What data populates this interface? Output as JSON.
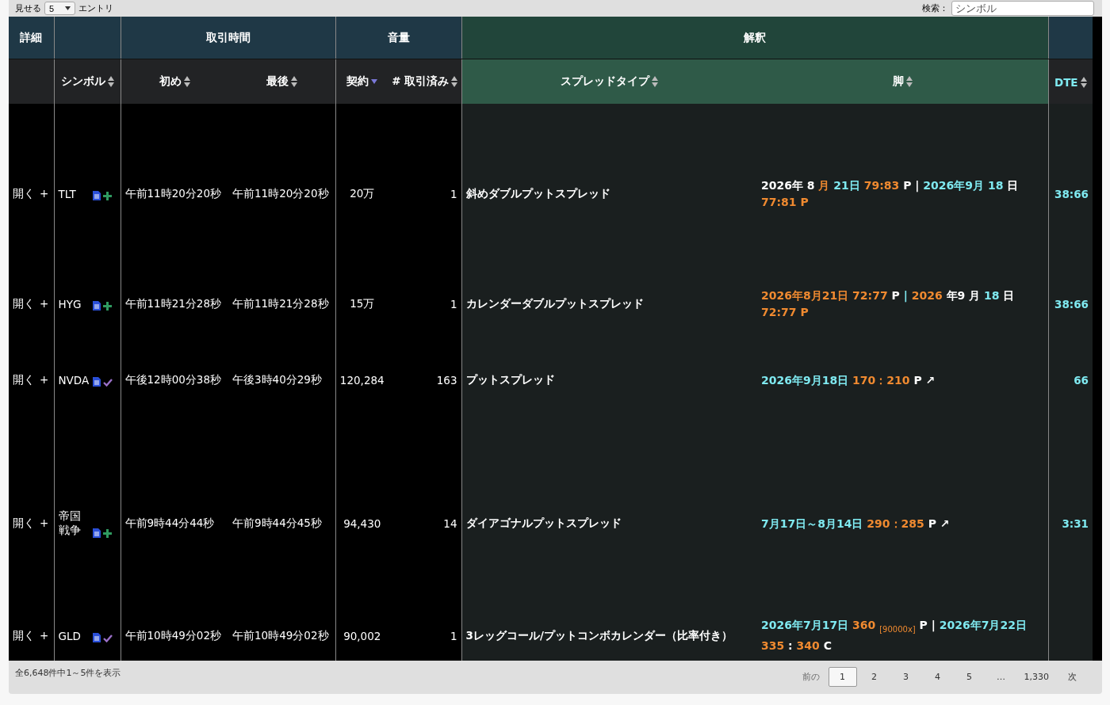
{
  "controls": {
    "show_label": "見せる",
    "page_size": "5",
    "entries_label": "エントリ",
    "search_label": "検索：",
    "search": {
      "placeholder": "シンボル"
    }
  },
  "table": {
    "groups": [
      {
        "label": "詳細",
        "kind": "blue"
      },
      {
        "kind": "blue"
      },
      {
        "label": "取引時間",
        "kind": "blue"
      },
      {
        "label": "音量",
        "kind": "blue"
      },
      {
        "label": "解釈",
        "kind": "green"
      },
      {
        "kind": "blue"
      }
    ],
    "columns": [
      {
        "sortable": false,
        "sorted_desc": false,
        "kind": "plain"
      },
      {
        "label": "シンボル",
        "sortable": true,
        "sorted_desc": false,
        "kind": "plain"
      },
      {
        "label": "初め",
        "sortable": true,
        "sorted_desc": false,
        "kind": "plain"
      },
      {
        "label": "最後",
        "sortable": true,
        "sorted_desc": false,
        "kind": "plain"
      },
      {
        "label": "契約",
        "sortable": true,
        "sorted_desc": true,
        "kind": "plain"
      },
      {
        "label": "# 取引済み",
        "sortable": true,
        "sorted_desc": false,
        "kind": "plain"
      },
      {
        "label": "スプレッドタイプ",
        "sortable": true,
        "sorted_desc": false,
        "kind": "green"
      },
      {
        "label": "脚",
        "sortable": true,
        "sorted_desc": false,
        "kind": "green"
      },
      {
        "label": "DTE",
        "sortable": true,
        "sorted_desc": false,
        "kind": "cyan"
      }
    ],
    "rows": [
      {
        "detail": "開く",
        "expand": "+",
        "symbol": "TLT",
        "kind": "plus",
        "first": "午前11時20分20秒",
        "last": "午前11時20分20秒",
        "contracts": "20万",
        "trades": "1",
        "spread": "斜めダブルプットスプレッド",
        "legs": [
          {
            "text": "2026年",
            "color": "#ffffff"
          },
          {
            "text": "8",
            "color": "#ffffff"
          },
          {
            "text": "月",
            "color": "#f08a30"
          },
          {
            "text": "21日",
            "color": "#7fe9f0"
          },
          {
            "text": "79:83",
            "color": "#f08a30"
          },
          {
            "text": "P",
            "color": "#ffffff"
          },
          {
            "text": "|",
            "color": "#ffffff"
          },
          {
            "text": "2026年9月",
            "color": "#7fe9f0"
          },
          {
            "text": "18",
            "color": "#7fe9f0"
          },
          {
            "text": "日",
            "color": "#ffffff"
          },
          {
            "text": "77:81 P",
            "color": "#f08a30"
          }
        ],
        "dte": "38:66"
      },
      {
        "detail": "開く",
        "expand": "+",
        "symbol": "HYG",
        "kind": "plus",
        "first": "午前11時21分28秒",
        "last": "午前11時21分28秒",
        "contracts": "15万",
        "trades": "1",
        "spread": "カレンダーダブルプットスプレッド",
        "legs": [
          {
            "text": "2026年8月21日 72:77",
            "color": "#f08a30"
          },
          {
            "text": "P",
            "color": "#ffffff"
          },
          {
            "text": "|",
            "color": "#7fe9f0"
          },
          {
            "text": "2026",
            "color": "#f08a30"
          },
          {
            "text": "年9",
            "color": "#ffffff"
          },
          {
            "text": "月",
            "color": "#ffffff"
          },
          {
            "text": "18",
            "color": "#7fe9f0"
          },
          {
            "text": "日",
            "color": "#ffffff"
          },
          {
            "text": "72:77 P",
            "color": "#f08a30"
          }
        ],
        "dte": "38:66"
      },
      {
        "detail": "開く",
        "expand": "+",
        "symbol": "NVDA",
        "kind": "check",
        "first": "午後12時00分38秒",
        "last": "午後3時40分29秒",
        "contracts": "120,284",
        "trades": "163",
        "spread": "プットスプレッド",
        "legs": [
          {
            "text": "2026年9月18日",
            "color": "#7fe9f0"
          },
          {
            "text": "170：210",
            "color": "#f08a30"
          },
          {
            "text": "P",
            "color": "#ffffff"
          },
          {
            "text": "↗",
            "color": "#ffffff"
          }
        ],
        "dte": "66"
      },
      {
        "detail": "開く",
        "expand": "+",
        "symbol": "帝国戦争",
        "kind": "plus",
        "first": "午前9時44分44秒",
        "last": "午前9時44分45秒",
        "contracts": "94,430",
        "trades": "14",
        "spread": "ダイアゴナルプットスプレッド",
        "legs": [
          {
            "text": "7月17日～8月14日",
            "color": "#7fe9f0"
          },
          {
            "text": "290：285",
            "color": "#f08a30"
          },
          {
            "text": "P",
            "color": "#ffffff"
          },
          {
            "text": "↗",
            "color": "#ffffff"
          }
        ],
        "dte": "3:31"
      },
      {
        "detail": "開く",
        "expand": "+",
        "symbol": "GLD",
        "kind": "check",
        "first": "午前10時49分02秒",
        "last": "午前10時49分02秒",
        "contracts": "90,002",
        "trades": "1",
        "spread": "3レッグコール/プットコンボカレンダー（比率付き）",
        "legs": [
          {
            "text": "2026年7月17日",
            "color": "#7fe9f0"
          },
          {
            "text": "360 $_{[90000x]}$",
            "color": "#f08a30"
          },
          {
            "text": "P",
            "color": "#ffffff"
          },
          {
            "text": "|",
            "color": "#ffffff"
          },
          {
            "text": "2026年7月22日",
            "color": "#7fe9f0"
          },
          {
            "text": "335",
            "color": "#f08a30"
          },
          {
            "text": ":",
            "color": "#ffffff"
          },
          {
            "text": "340",
            "color": "#f08a30"
          },
          {
            "text": "C",
            "color": "#ffffff"
          }
        ]
      }
    ]
  },
  "footer": {
    "info": "全6,648件中1～5件を表示",
    "prev": "前の",
    "next": "次",
    "pages": [
      {
        "label": "1",
        "selected": true
      },
      {
        "label": "2",
        "selected": false
      },
      {
        "label": "3",
        "selected": false
      },
      {
        "label": "4",
        "selected": false
      },
      {
        "label": "5",
        "selected": false
      },
      {
        "label": "…",
        "selected": false
      },
      {
        "label": "1,330",
        "selected": false
      }
    ]
  }
}
